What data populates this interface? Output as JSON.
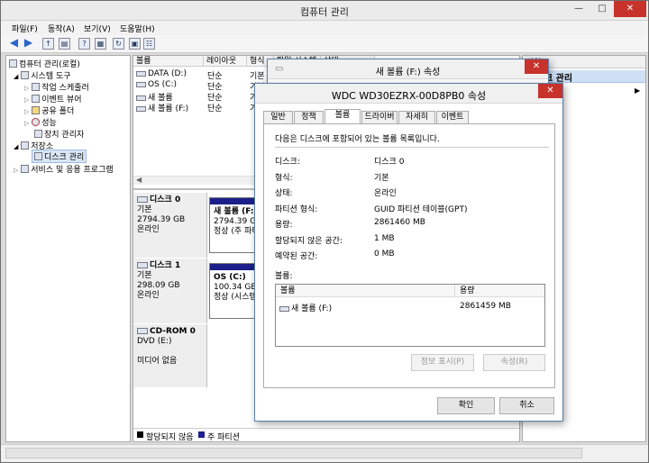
{
  "window": {
    "title": "컴퓨터 관리"
  },
  "menu": [
    "파일(F)",
    "동작(A)",
    "보기(V)",
    "도움말(H)"
  ],
  "tree": {
    "items": [
      "컴퓨터 관리(로컬)",
      "시스템 도구",
      "작업 스케줄러",
      "이벤트 뷰어",
      "공유 폴더",
      "성능",
      "장치 관리자",
      "저장소",
      "디스크 관리",
      "서비스 및 응용 프로그램"
    ]
  },
  "volumes": {
    "headers": [
      "볼륨",
      "레이아웃",
      "형식",
      "파일 시스템",
      "상태"
    ],
    "rows": [
      {
        "name": "DATA (D:)",
        "layout": "단순",
        "type": "기본"
      },
      {
        "name": "OS (C:)",
        "layout": "단순",
        "type": "기본"
      },
      {
        "name": "새 볼륨",
        "layout": "단순",
        "type": "기본"
      },
      {
        "name": "새 볼륨 (F:)",
        "layout": "단순",
        "type": "기본"
      }
    ]
  },
  "disks": [
    {
      "name": "디스크 0",
      "type": "기본",
      "size": "2794.39 GB",
      "status": "온라인",
      "part_name": "새 볼륨  (F:)",
      "part_size": "2794.39 GB",
      "part_status": "정상 (주 파티"
    },
    {
      "name": "디스크 1",
      "type": "기본",
      "size": "298.09 GB",
      "status": "온라인",
      "part_name": "OS  (C:)",
      "part_size": "100.34 GB N",
      "part_status": "정상 (시스템"
    },
    {
      "name": "CD-ROM 0",
      "type": "DVD (E:)",
      "size": "",
      "status": "미디어 없음"
    }
  ],
  "legend": {
    "unallocated": "할당되지 않음",
    "primary": "주 파티션"
  },
  "actions": {
    "header": "작업",
    "item": "크 관리",
    "sub": "작업"
  },
  "back_dialog": {
    "title": "새 볼륨 (F:) 속성"
  },
  "dialog": {
    "title": "WDC WD30EZRX-00D8PB0 속성",
    "tabs": [
      "일반",
      "정책",
      "볼륨",
      "드라이버",
      "자세히",
      "이벤트"
    ],
    "description": "다음은 디스크에 포함되어 있는 볼륨 목록입니다.",
    "fields": [
      {
        "label": "디스크:",
        "value": "디스크 0"
      },
      {
        "label": "형식:",
        "value": "기본"
      },
      {
        "label": "상태:",
        "value": "온라인"
      },
      {
        "label": "파티션 형식:",
        "value": "GUID 파티션 테이블(GPT)"
      },
      {
        "label": "용량:",
        "value": "2861460 MB"
      },
      {
        "label": "할당되지 않은 공간:",
        "value": "1 MB"
      },
      {
        "label": "예약된 공간:",
        "value": "0 MB"
      }
    ],
    "volumes_label": "볼륨:",
    "list_headers": [
      "볼륨",
      "용량"
    ],
    "list_rows": [
      {
        "name": "새 볼륨 (F:)",
        "size": "2861459 MB"
      }
    ],
    "populate_button": "정보 표시(P)",
    "properties_button": "속성(R)",
    "ok_button": "확인",
    "cancel_button": "취소"
  }
}
